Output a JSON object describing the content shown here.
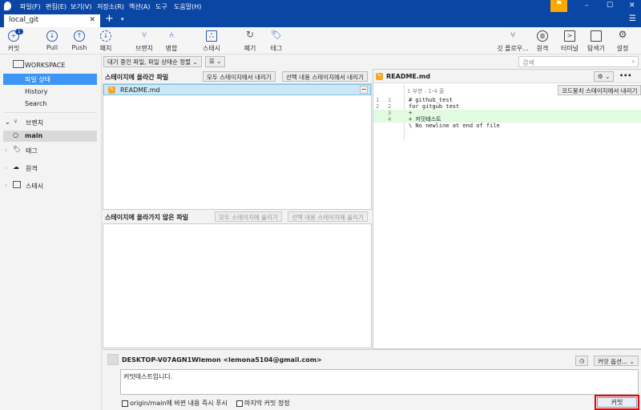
{
  "menu": [
    "파일(F)",
    "편집(E)",
    "보기(V)",
    "저장소(R)",
    "액션(A)",
    "도구",
    "도움말(H)"
  ],
  "tab": {
    "label": "local_git",
    "close": "✕",
    "add": "+"
  },
  "toolbar": {
    "commit": "커밋",
    "commit_badge": "1",
    "pull": "Pull",
    "push": "Push",
    "fetch": "패치",
    "branch": "브랜치",
    "merge": "병합",
    "stash": "스태시",
    "discard": "폐기",
    "tag": "태그",
    "gitflow": "깃 플로우...",
    "remote": "원격",
    "terminal": "터미널",
    "explorer": "탐색기",
    "settings": "설정"
  },
  "sidebar": {
    "workspace": "WORKSPACE",
    "file_status": "파일 상태",
    "history": "History",
    "search": "Search",
    "branches": "브랜치",
    "main": "main",
    "tags": "태그",
    "remotes": "원격",
    "stashes": "스태시"
  },
  "filter": {
    "sort": "대기 중인 파일, 파일 상태순 정렬",
    "search_placeholder": "검색"
  },
  "staged": {
    "title": "스테이지에 올라간 파일",
    "unstage_all": "모두 스테이지에서 내리기",
    "unstage_selected": "선택 내용 스테이지에서 내리기",
    "files": [
      "README.md"
    ]
  },
  "unstaged": {
    "title": "스테이지에 올라가지 않은 파일",
    "stage_all": "모두 스테이지에 올리기",
    "stage_selected": "선택 내용 스테이지에 올리기"
  },
  "diff": {
    "file": "README.md",
    "hunk": "1 부분 : 1-4 줄",
    "unstage_hunk": "코드뭉치 스테이지에서 내리기",
    "lines": [
      {
        "old": "1",
        "new": "1",
        "text": "  # github_test",
        "type": "ctx"
      },
      {
        "old": "2",
        "new": "2",
        "text": "  for gitgub test",
        "type": "ctx"
      },
      {
        "old": "",
        "new": "3",
        "text": "+",
        "type": "add"
      },
      {
        "old": "",
        "new": "4",
        "text": "+ 커밋테스트",
        "type": "add"
      },
      {
        "old": "",
        "new": "",
        "text": "\\  No newline at end of file",
        "type": "ctx"
      }
    ]
  },
  "commit": {
    "author": "DESKTOP-V07AGN1Wlemon <lemona5104@gmail.com>",
    "options": "커밋 옵션...",
    "message": "커밋테스트입니다.",
    "push_label": "origin/main에 바뀐 내용 즉시 푸시",
    "amend_label": "마지막 커밋 정정",
    "commit_button": "커밋"
  }
}
